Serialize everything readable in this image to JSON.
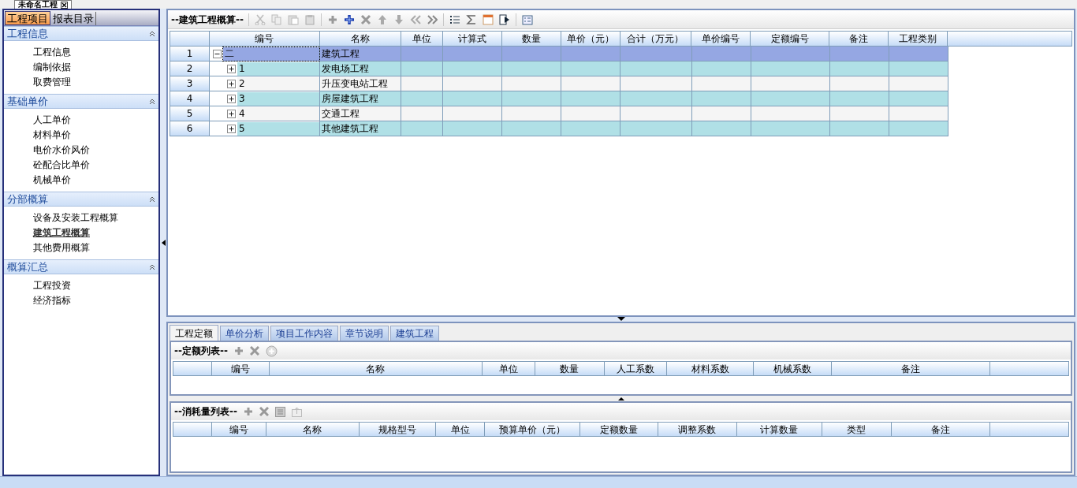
{
  "document_tab": {
    "title": "未命名工程"
  },
  "sidebar": {
    "tabs": [
      {
        "label": "工程项目",
        "selected": true
      },
      {
        "label": "报表目录",
        "selected": false
      }
    ],
    "sections": [
      {
        "title": "工程信息",
        "expanded": true,
        "items": [
          {
            "label": "工程信息",
            "selected": false
          },
          {
            "label": "编制依据",
            "selected": false
          },
          {
            "label": "取费管理",
            "selected": false
          }
        ]
      },
      {
        "title": "基础单价",
        "expanded": true,
        "items": [
          {
            "label": "人工单价",
            "selected": false
          },
          {
            "label": "材料单价",
            "selected": false
          },
          {
            "label": "电价水价风价",
            "selected": false
          },
          {
            "label": "砼配合比单价",
            "selected": false
          },
          {
            "label": "机械单价",
            "selected": false
          }
        ]
      },
      {
        "title": "分部概算",
        "expanded": true,
        "items": [
          {
            "label": "设备及安装工程概算",
            "selected": false
          },
          {
            "label": "建筑工程概算",
            "selected": true
          },
          {
            "label": "其他费用概算",
            "selected": false
          }
        ]
      },
      {
        "title": "概算汇总",
        "expanded": true,
        "items": [
          {
            "label": "工程投资",
            "selected": false
          },
          {
            "label": "经济指标",
            "selected": false
          }
        ]
      }
    ]
  },
  "main_grid": {
    "title": "--建筑工程概算--",
    "columns": [
      "编号",
      "名称",
      "单位",
      "计算式",
      "数量",
      "单价（元）",
      "合计（万元）",
      "单价编号",
      "定额编号",
      "备注",
      "工程类别"
    ],
    "rows": [
      {
        "row_number": "1",
        "code": "二",
        "name": "建筑工程",
        "expanded": true,
        "selected": true,
        "children": [
          {
            "row_number": "2",
            "code": "1",
            "name": "发电场工程",
            "expanded": false,
            "selected": false
          },
          {
            "row_number": "3",
            "code": "2",
            "name": "升压变电站工程",
            "expanded": false,
            "selected": false
          },
          {
            "row_number": "4",
            "code": "3",
            "name": "房屋建筑工程",
            "expanded": false,
            "selected": false
          },
          {
            "row_number": "5",
            "code": "4",
            "name": "交通工程",
            "expanded": false,
            "selected": false
          },
          {
            "row_number": "6",
            "code": "5",
            "name": "其他建筑工程",
            "expanded": false,
            "selected": false
          }
        ]
      }
    ]
  },
  "bottom_tabs": [
    {
      "label": "工程定额",
      "selected": true
    },
    {
      "label": "单价分析",
      "selected": false
    },
    {
      "label": "项目工作内容",
      "selected": false
    },
    {
      "label": "章节说明",
      "selected": false
    },
    {
      "label": "建筑工程",
      "selected": false
    }
  ],
  "quota_list": {
    "title": "--定额列表--",
    "columns": [
      "编号",
      "名称",
      "单位",
      "数量",
      "人工系数",
      "材料系数",
      "机械系数",
      "备注"
    ]
  },
  "consumption_list": {
    "title": "--消耗量列表--",
    "columns": [
      "编号",
      "名称",
      "规格型号",
      "单位",
      "预算单价（元）",
      "定额数量",
      "调整系数",
      "计算数量",
      "类型",
      "备注"
    ]
  }
}
